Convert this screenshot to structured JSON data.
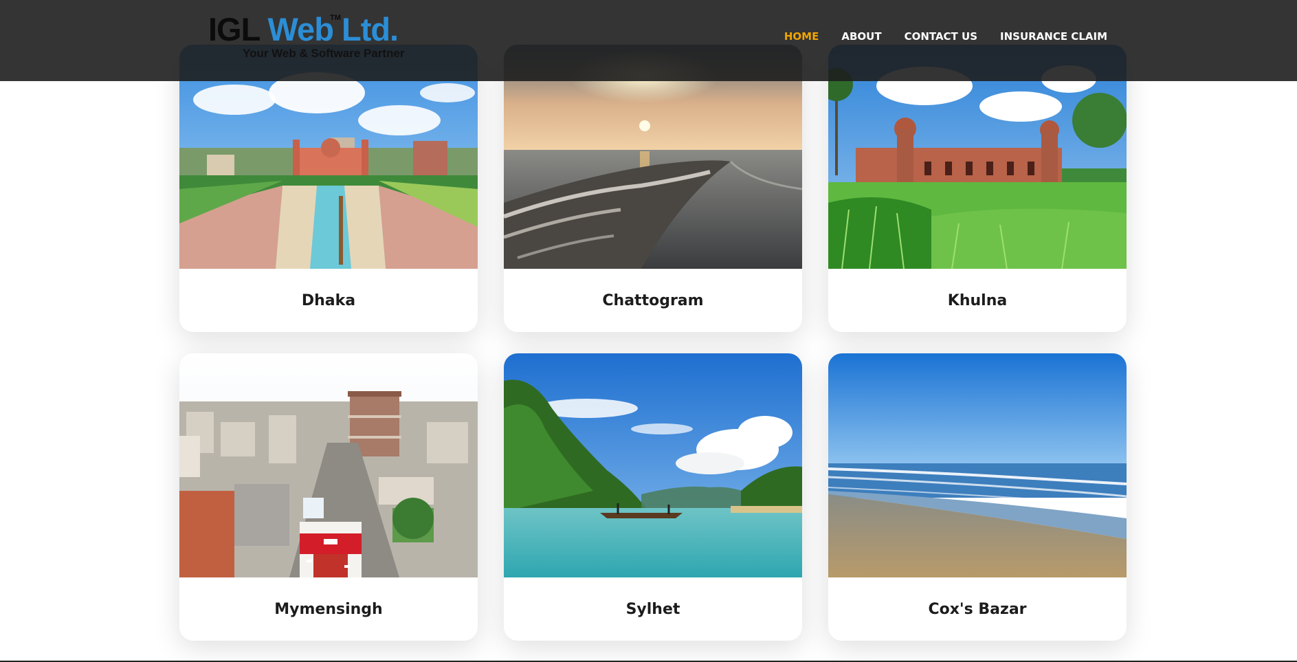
{
  "header": {
    "logo": {
      "brand_part1": "IGL",
      "brand_part2": "Web",
      "brand_part3": "Ltd.",
      "trademark": "TM",
      "tagline": "Your Web & Software Partner"
    },
    "nav": [
      {
        "label": "HOME",
        "active": true
      },
      {
        "label": "ABOUT",
        "active": false
      },
      {
        "label": "CONTACT US",
        "active": false
      },
      {
        "label": "INSURANCE CLAIM",
        "active": false
      }
    ]
  },
  "colors": {
    "header_bg": "#1e1e1e",
    "nav_active": "#f0a500",
    "nav_text": "#ffffff",
    "logo_blue": "#2b8ed6",
    "card_title": "#1c1c1c"
  },
  "cards": [
    {
      "title": "Dhaka",
      "image": "lalbagh-fort-photo"
    },
    {
      "title": "Chattogram",
      "image": "sunset-beach-waves-photo"
    },
    {
      "title": "Khulna",
      "image": "sixty-dome-mosque-photo"
    },
    {
      "title": "Mymensingh",
      "image": "aerial-city-street-photo"
    },
    {
      "title": "Sylhet",
      "image": "river-hills-boat-photo"
    },
    {
      "title": "Cox's Bazar",
      "image": "sea-beach-blue-sky-photo"
    }
  ]
}
